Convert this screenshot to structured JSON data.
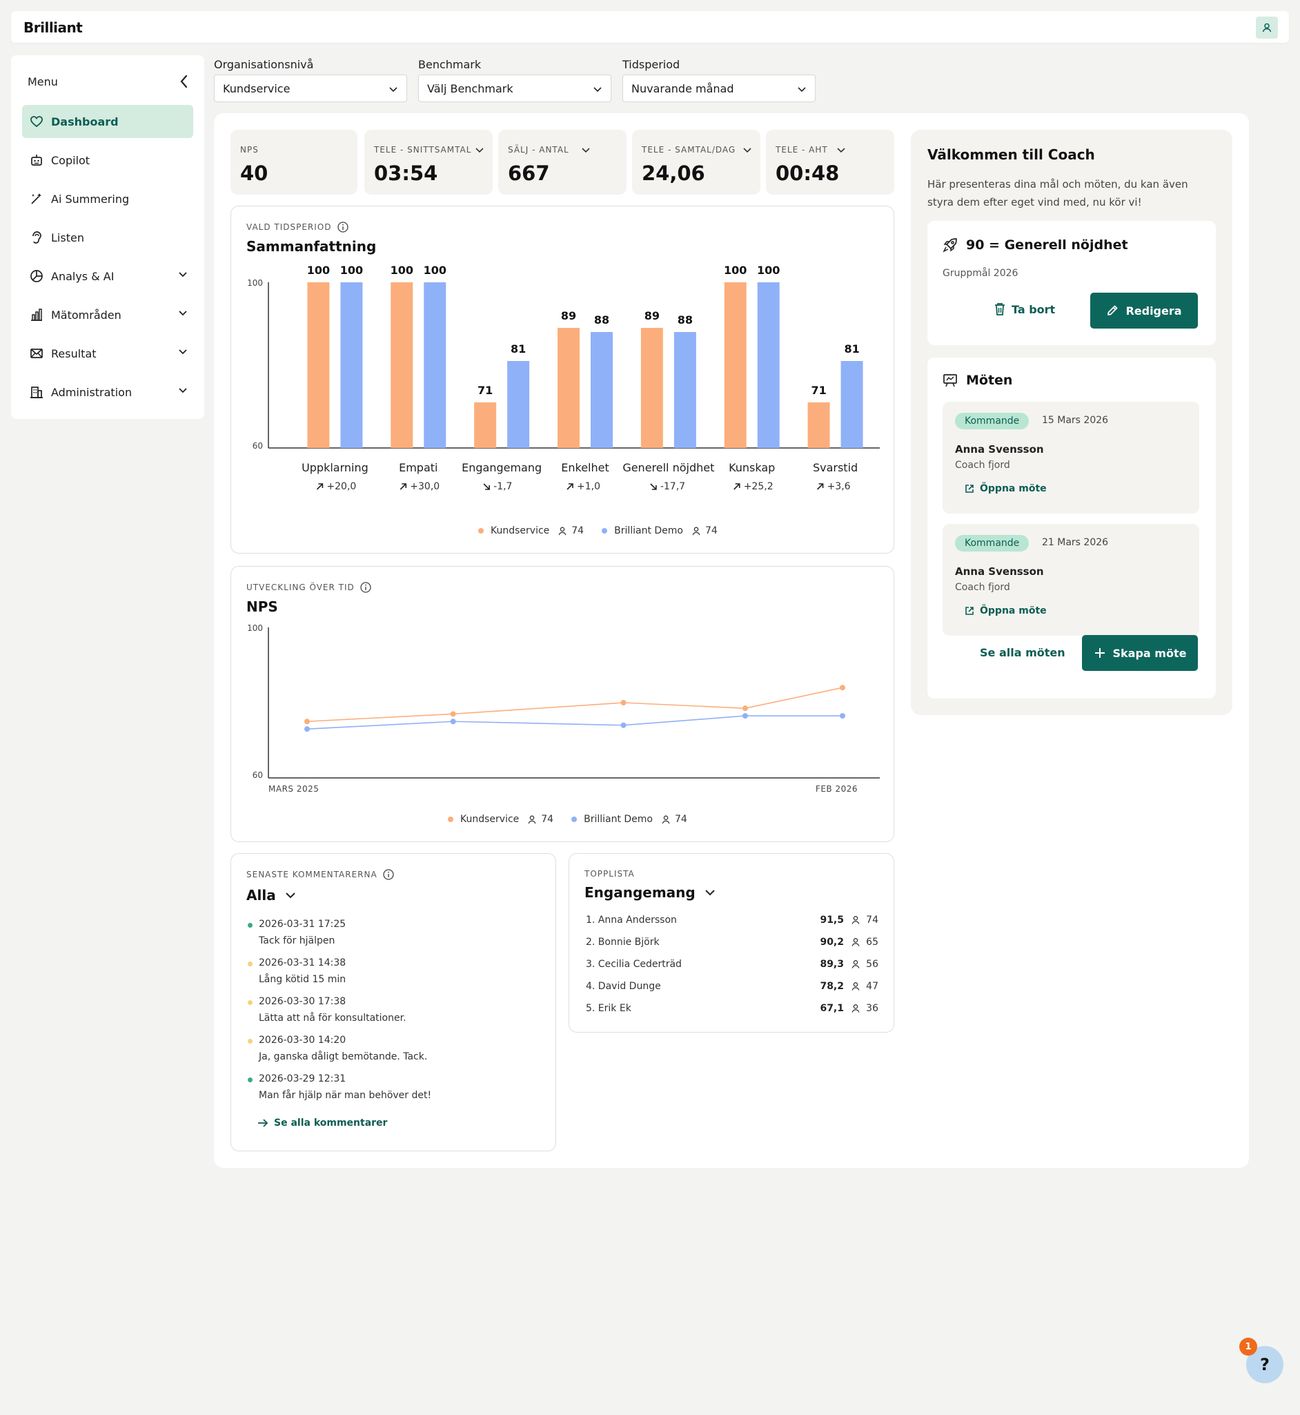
{
  "app": {
    "logo": "Brilliant"
  },
  "menu": {
    "title": "Menu",
    "items": [
      {
        "label": "Dashboard",
        "icon": "heart-icon",
        "active": true
      },
      {
        "label": "Copilot",
        "icon": "robot-icon"
      },
      {
        "label": "Ai Summering",
        "icon": "wand-icon"
      },
      {
        "label": "Listen",
        "icon": "ear-icon"
      },
      {
        "label": "Analys & AI",
        "icon": "pie-chart-icon",
        "expandable": true
      },
      {
        "label": "Mätområden",
        "icon": "bar-chart-icon",
        "expandable": true
      },
      {
        "label": "Resultat",
        "icon": "mail-icon",
        "expandable": true
      },
      {
        "label": "Administration",
        "icon": "building-icon",
        "expandable": true
      }
    ]
  },
  "filters": {
    "org": {
      "label": "Organisationsnivå",
      "value": "Kundservice"
    },
    "benchmark": {
      "label": "Benchmark",
      "value": "Välj Benchmark"
    },
    "period": {
      "label": "Tidsperiod",
      "value": "Nuvarande månad"
    }
  },
  "kpis": [
    {
      "label": "NPS",
      "value": "40",
      "dropdown": false
    },
    {
      "label": "TELE - SNITTSAMTAL",
      "value": "03:54",
      "dropdown": true
    },
    {
      "label": "SÄLJ - ANTAL",
      "value": "667",
      "dropdown": true
    },
    {
      "label": "TELE - SAMTAL/DAG",
      "value": "24,06",
      "dropdown": true
    },
    {
      "label": "TELE - AHT",
      "value": "00:48",
      "dropdown": true
    }
  ],
  "summary": {
    "eyebrow": "VALD TIDSPERIOD",
    "title": "Sammanfattning"
  },
  "trend": {
    "eyebrow": "UTVECKLING ÖVER TID",
    "title": "NPS"
  },
  "legend": [
    {
      "name": "Kundservice",
      "count": "74"
    },
    {
      "name": "Brilliant Demo",
      "count": "74"
    }
  ],
  "colors": {
    "orange": "#fbae7b",
    "blue": "#8fb1f7",
    "teal": "#0d665c",
    "mint": "#d4ebe0"
  },
  "chart_data": [
    {
      "type": "bar",
      "categories": [
        "Uppklarning",
        "Empati",
        "Engangemang",
        "Enkelhet",
        "Generell nöjdhet",
        "Kunskap",
        "Svarstid"
      ],
      "series": [
        {
          "name": "Kundservice",
          "values": [
            100,
            100,
            71,
            89,
            89,
            100,
            71
          ]
        },
        {
          "name": "Brilliant Demo",
          "values": [
            100,
            100,
            81,
            88,
            88,
            100,
            81
          ]
        }
      ],
      "deltas": [
        {
          "dir": "up",
          "text": "+20,0"
        },
        {
          "dir": "up",
          "text": "+30,0"
        },
        {
          "dir": "down",
          "text": "-1,7"
        },
        {
          "dir": "up",
          "text": "+1,0"
        },
        {
          "dir": "down",
          "text": "-17,7"
        },
        {
          "dir": "up",
          "text": "+25,2"
        },
        {
          "dir": "up",
          "text": "+3,6"
        }
      ],
      "ylim": [
        60,
        100
      ],
      "yticks": [
        "100",
        "60"
      ]
    },
    {
      "type": "line",
      "x": [
        "2025-03",
        "2025-06",
        "2025-09",
        "2025-12",
        "2026-02"
      ],
      "x_positions_months": [
        0,
        3,
        6.5,
        9,
        11
      ],
      "series": [
        {
          "name": "Kundservice",
          "values": [
            75,
            77,
            80,
            78.5,
            84
          ]
        },
        {
          "name": "Brilliant Demo",
          "values": [
            73,
            75,
            74,
            76.5,
            76.5
          ]
        }
      ],
      "ylim": [
        60,
        100
      ],
      "yticks": [
        "100",
        "60"
      ],
      "xticks": [
        "MARS 2025",
        "FEB 2026"
      ]
    }
  ],
  "coach": {
    "title": "Välkommen till Coach",
    "intro": "Här presenteras dina mål och möten, du kan även styra dem efter eget vind med, nu kör vi!",
    "goal": {
      "title": "90 = Generell nöjdhet",
      "sub": "Gruppmål 2026",
      "delete": "Ta bort",
      "edit": "Redigera"
    },
    "meetings_title": "Möten",
    "meetings": [
      {
        "status": "Kommande",
        "date": "15 Mars 2026",
        "name": "Anna Svensson",
        "role": "Coach fjord",
        "open": "Öppna möte"
      },
      {
        "status": "Kommande",
        "date": "21 Mars 2026",
        "name": "Anna Svensson",
        "role": "Coach fjord",
        "open": "Öppna möte"
      }
    ],
    "see_all": "Se alla möten",
    "create": "Skapa möte"
  },
  "comments": {
    "eyebrow": "SENASTE KOMMENTARERNA",
    "filter": "Alla",
    "items": [
      {
        "date": "2026-03-31 17:25",
        "text": "Tack för hjälpen",
        "color": "#3aaa86"
      },
      {
        "date": "2026-03-31 14:38",
        "text": "Lång kötid 15 min",
        "color": "#f7d27b"
      },
      {
        "date": "2026-03-30 17:38",
        "text": "Lätta att nå för konsultationer.",
        "color": "#f7d27b"
      },
      {
        "date": "2026-03-30 14:20",
        "text": "Ja, ganska dåligt bemötande. Tack.",
        "color": "#f7d27b"
      },
      {
        "date": "2026-03-29 12:31",
        "text": "Man får hjälp när man behöver det!",
        "color": "#3aaa86"
      }
    ],
    "see_all": "Se alla kommentarer"
  },
  "toplist": {
    "eyebrow": "TOPPLISTA",
    "title": "Engangemang",
    "rows": [
      {
        "name": "1. Anna Andersson",
        "score": "91,5",
        "count": "74"
      },
      {
        "name": "2. Bonnie Björk",
        "score": "90,2",
        "count": "65"
      },
      {
        "name": "3. Cecilia Cederträd",
        "score": "89,3",
        "count": "56"
      },
      {
        "name": "4. David Dunge",
        "score": "78,2",
        "count": "47"
      },
      {
        "name": "5. Erik Ek",
        "score": "67,1",
        "count": "36"
      }
    ]
  },
  "help": {
    "label": "?",
    "badge": "1"
  }
}
